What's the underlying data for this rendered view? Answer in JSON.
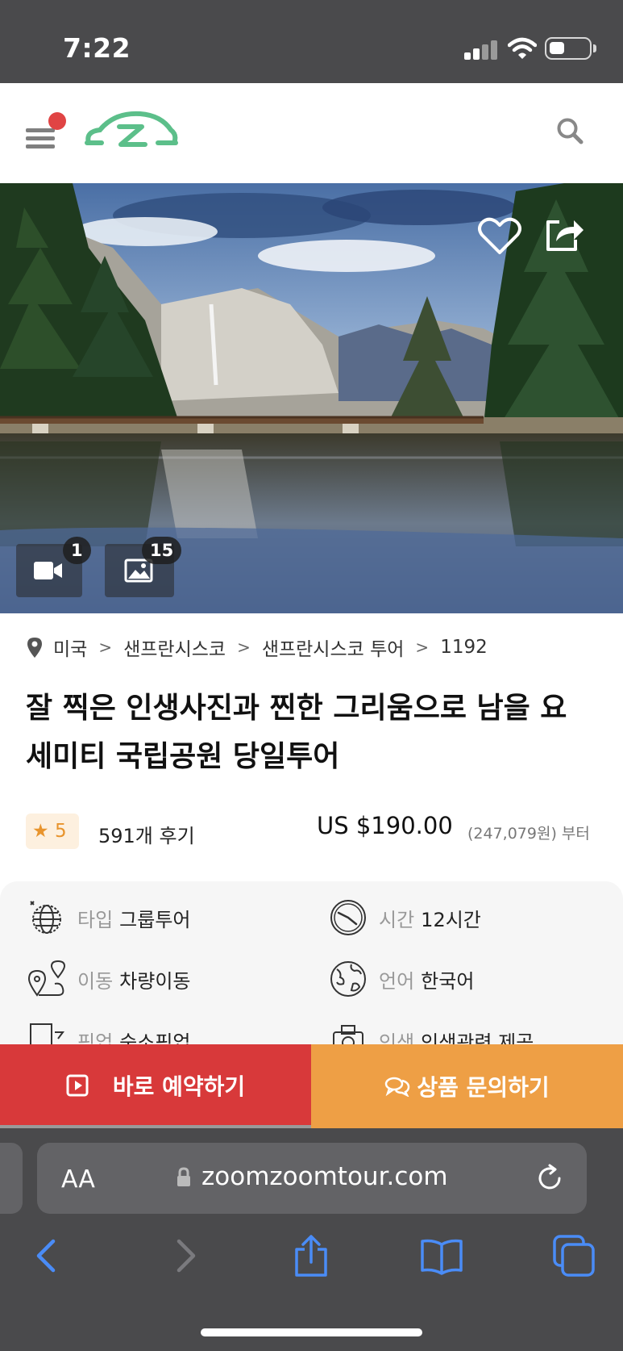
{
  "status_bar": {
    "time": "7:22"
  },
  "hero": {
    "video_count": "1",
    "photo_count": "15"
  },
  "breadcrumb": [
    "미국",
    "샌프란시스코",
    "샌프란시스코 투어",
    "1192"
  ],
  "product": {
    "title_line1": "잘 찍은 인생사진과 찐한 그리움으로 남을 요",
    "title_line2": "세미티 국립공원 당일투어",
    "rating": "5",
    "reviews": "591개 후기",
    "price": "US $190.00",
    "price_krw": "(247,079원) 부터"
  },
  "info": [
    {
      "label": "타입",
      "value": "그룹투어",
      "icon": "globe-icon"
    },
    {
      "label": "시간",
      "value": "12시간",
      "icon": "clock-icon"
    },
    {
      "label": "이동",
      "value": "차량이동",
      "icon": "route-icon"
    },
    {
      "label": "언어",
      "value": "한국어",
      "icon": "earth-icon"
    },
    {
      "label": "픽업",
      "value": "숙소픽업",
      "icon": "pickup-icon"
    },
    {
      "label": "인생",
      "value": "인생관련 제공",
      "icon": "camera-icon"
    }
  ],
  "actions": {
    "book": "바로 예약하기",
    "inquiry": "상품 문의하기"
  },
  "browser": {
    "aa": "AA",
    "url": "zoomzoomtour.com"
  },
  "colors": {
    "accent_red": "#d8393a",
    "accent_orange": "#ee9f45",
    "logo_green": "#5cbf8a",
    "browser_blue": "#4a8cf7"
  }
}
